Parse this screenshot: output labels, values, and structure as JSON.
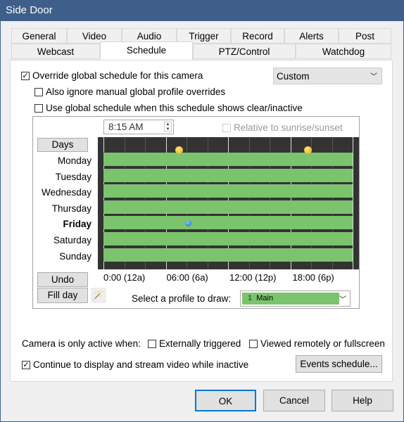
{
  "window": {
    "title": "Side Door"
  },
  "tabs_row1": [
    "General",
    "Video",
    "Audio",
    "Trigger",
    "Record",
    "Alerts",
    "Post"
  ],
  "tabs_row2": [
    "Webcast",
    "Schedule",
    "PTZ/Control",
    "Watchdog"
  ],
  "selected_tab": "Schedule",
  "options": {
    "override": {
      "label": "Override global schedule for this camera",
      "checked": true
    },
    "preset": "Custom",
    "ignore_manual": {
      "label": "Also ignore manual global profile overrides",
      "checked": false
    },
    "use_global": {
      "label": "Use global schedule when this schedule shows clear/inactive",
      "checked": false
    }
  },
  "schedule": {
    "time": "8:15 AM",
    "relative": {
      "label": "Relative to sunrise/sunset",
      "checked": false
    },
    "days_button": "Days",
    "days": [
      "Monday",
      "Tuesday",
      "Wednesday",
      "Thursday",
      "Friday",
      "Saturday",
      "Sunday"
    ],
    "selected_day": "Friday",
    "time_ticks": [
      "0:00 (12a)",
      "06:00 (6a)",
      "12:00 (12p)",
      "18:00 (6p)"
    ],
    "undo": "Undo",
    "fill_day": "Fill day",
    "profile_label": "Select a profile to draw:",
    "profile": {
      "number": "1",
      "name": "Main",
      "color": "#7cc36e"
    }
  },
  "active_when": {
    "label": "Camera is only active when:",
    "externally": {
      "label": "Externally triggered",
      "checked": false
    },
    "viewed": {
      "label": "Viewed remotely or fullscreen",
      "checked": false
    }
  },
  "continue": {
    "label": "Continue to display and stream video while inactive",
    "checked": true
  },
  "events_button": "Events schedule...",
  "buttons": {
    "ok": "OK",
    "cancel": "Cancel",
    "help": "Help"
  }
}
